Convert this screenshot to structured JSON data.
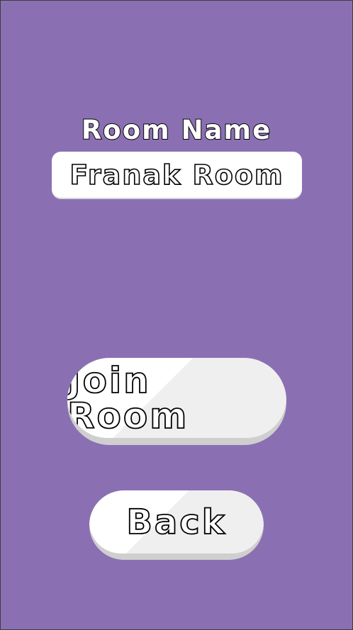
{
  "room_name_label": "Room Name",
  "room_name_field": {
    "value": "Franak Room"
  },
  "buttons": {
    "join": "Join Room",
    "back": "Back"
  },
  "colors": {
    "background": "#8a70b3",
    "button_face": "#ffffff",
    "button_shade": "#efefef",
    "button_base": "#cfcfcf",
    "text_fill": "#ffffff",
    "text_outline": "#000000"
  }
}
